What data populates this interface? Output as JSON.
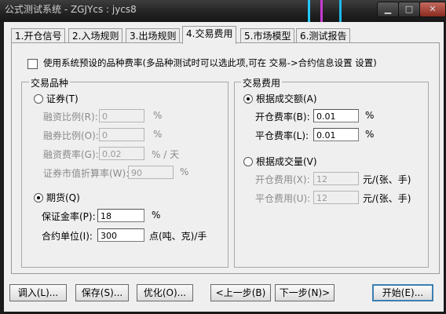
{
  "window": {
    "title": "公式测试系统 - ZGJYcs : jycs8"
  },
  "tabs": [
    "1.开仓信号",
    "2.入场规则",
    "3.出场规则",
    "4.交易费用",
    "5.市场模型",
    "6.测试报告"
  ],
  "use_preset": {
    "label": "使用系统预设的品种费率(多品种测试时可以选此项,可在 交易->合约信息设置 设置)"
  },
  "instrument_group": {
    "legend": "交易品种",
    "securities": {
      "label": "证券(T)",
      "margin_ratio": {
        "label": "融资比例(R):",
        "value": "0",
        "unit": "%"
      },
      "short_ratio": {
        "label": "融券比例(O):",
        "value": "0",
        "unit": "%"
      },
      "financing_rate": {
        "label": "融资费率(G):",
        "value": "0.02",
        "unit": "% / 天"
      },
      "market_value_ratio": {
        "label": "证券市值折算率(W):",
        "value": "90",
        "unit": "%"
      }
    },
    "futures": {
      "label": "期货(Q)",
      "deposit_rate": {
        "label": "保证金率(P):",
        "value": "18",
        "unit": "%"
      },
      "contract_unit": {
        "label": "合约单位(I):",
        "value": "300",
        "unit": "点(吨、克)/手"
      }
    }
  },
  "fee_group": {
    "legend": "交易费用",
    "by_amount": {
      "label": "根据成交额(A)",
      "open_rate": {
        "label": "开仓费率(B):",
        "value": "0.01",
        "unit": "%"
      },
      "close_rate": {
        "label": "平仓费率(L):",
        "value": "0.01",
        "unit": "%"
      }
    },
    "by_volume": {
      "label": "根据成交量(V)",
      "open_fee": {
        "label": "开仓费用(X):",
        "value": "12",
        "unit": "元/(张、手)"
      },
      "close_fee": {
        "label": "平仓费用(U):",
        "value": "12",
        "unit": "元/(张、手)"
      }
    }
  },
  "buttons": {
    "import": "调入(L)...",
    "save": "保存(S)...",
    "optimize": "优化(O)...",
    "prev": "<上一步(B)",
    "next": "下一步(N)>",
    "start": "开始(E)..."
  }
}
